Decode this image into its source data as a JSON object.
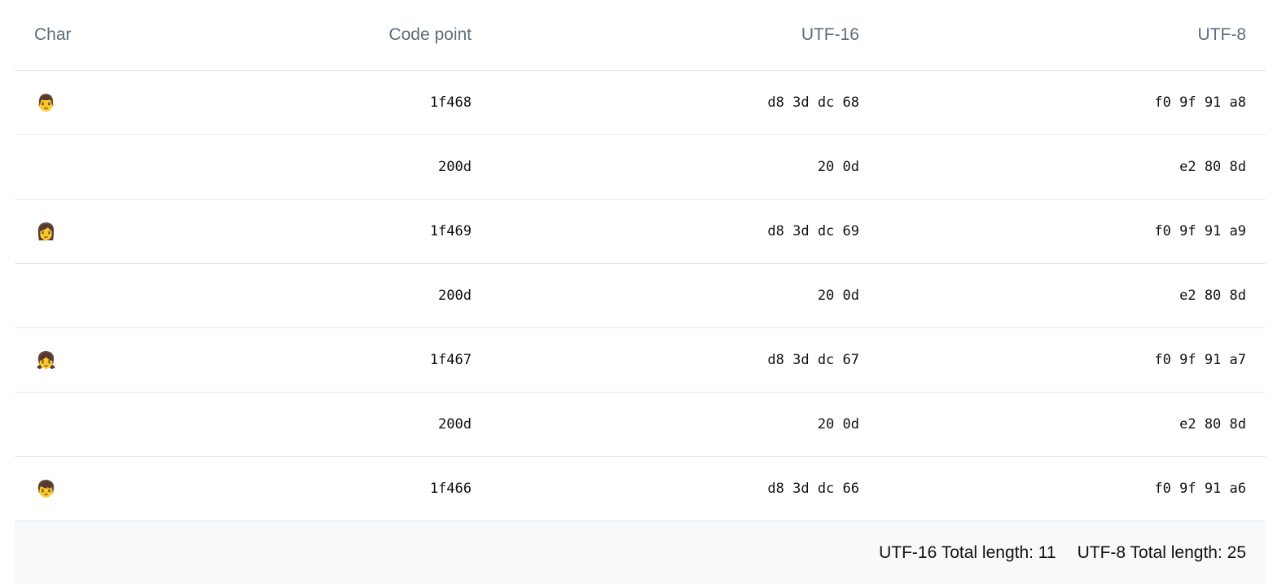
{
  "table": {
    "headers": {
      "char": "Char",
      "code_point": "Code point",
      "utf16": "UTF-16",
      "utf8": "UTF-8"
    },
    "rows": [
      {
        "char": "👨",
        "char_icon": "man-emoji-icon",
        "code_point": "1f468",
        "utf16": "d8 3d dc 68",
        "utf8": "f0 9f 91 a8"
      },
      {
        "char": "",
        "char_icon": "zero-width-joiner",
        "code_point": "200d",
        "utf16": "20 0d",
        "utf8": "e2 80 8d"
      },
      {
        "char": "👩",
        "char_icon": "woman-emoji-icon",
        "code_point": "1f469",
        "utf16": "d8 3d dc 69",
        "utf8": "f0 9f 91 a9"
      },
      {
        "char": "",
        "char_icon": "zero-width-joiner",
        "code_point": "200d",
        "utf16": "20 0d",
        "utf8": "e2 80 8d"
      },
      {
        "char": "👧",
        "char_icon": "girl-emoji-icon",
        "code_point": "1f467",
        "utf16": "d8 3d dc 67",
        "utf8": "f0 9f 91 a7"
      },
      {
        "char": "",
        "char_icon": "zero-width-joiner",
        "code_point": "200d",
        "utf16": "20 0d",
        "utf8": "e2 80 8d"
      },
      {
        "char": "👦",
        "char_icon": "boy-emoji-icon",
        "code_point": "1f466",
        "utf16": "d8 3d dc 66",
        "utf8": "f0 9f 91 a6"
      }
    ]
  },
  "footer": {
    "utf16_total": "UTF-16 Total length: 11",
    "utf8_total": "UTF-8 Total length: 25"
  },
  "colors": {
    "header_text": "#5f6b7a",
    "border": "#e2e7ee",
    "footer_bg": "#f8f9fa",
    "body_text": "#111111"
  }
}
